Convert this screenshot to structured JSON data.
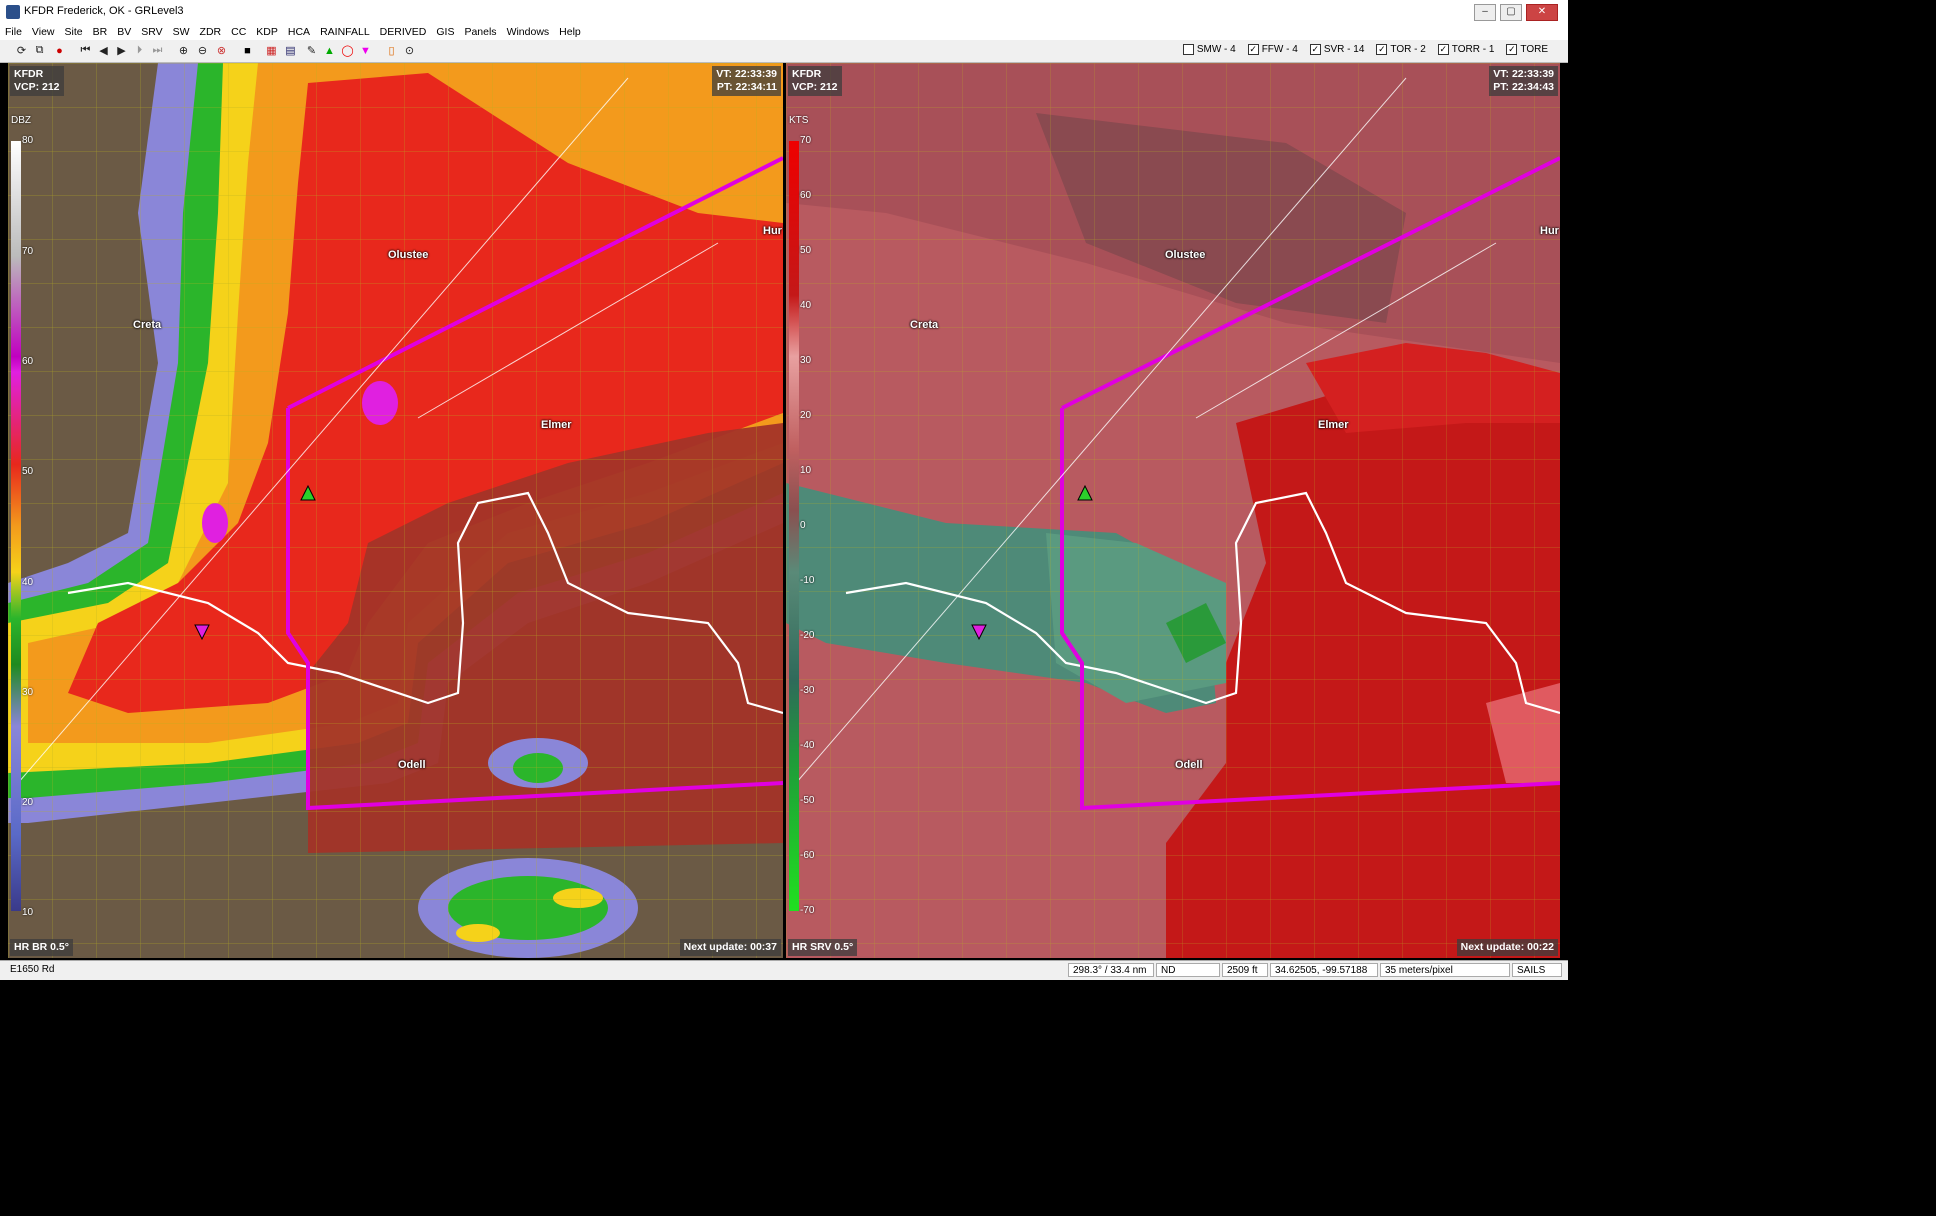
{
  "window": {
    "title": "KFDR Frederick, OK - GRLevel3"
  },
  "menu": [
    "File",
    "View",
    "Site",
    "BR",
    "BV",
    "SRV",
    "SW",
    "ZDR",
    "CC",
    "KDP",
    "HCA",
    "RAINFALL",
    "DERIVED",
    "GIS",
    "Panels",
    "Windows",
    "Help"
  ],
  "warnings": [
    {
      "label": "SMW - 4",
      "checked": false
    },
    {
      "label": "FFW - 4",
      "checked": true
    },
    {
      "label": "SVR - 14",
      "checked": true
    },
    {
      "label": "TOR - 2",
      "checked": true
    },
    {
      "label": "TORR - 1",
      "checked": true
    },
    {
      "label": "TORE",
      "checked": true
    }
  ],
  "left_panel": {
    "site": "KFDR",
    "vcp": "VCP: 212",
    "vt": "VT: 22:33:39",
    "pt": "PT: 22:34:11",
    "product": "HR BR 0.5°",
    "next_update": "Next update: 00:37",
    "unit": "DBZ",
    "scale_labels": [
      "80",
      "70",
      "60",
      "50",
      "40",
      "30",
      "20",
      "10"
    ]
  },
  "right_panel": {
    "site": "KFDR",
    "vcp": "VCP: 212",
    "vt": "VT: 22:33:39",
    "pt": "PT: 22:34:43",
    "product": "HR SRV 0.5°",
    "next_update": "Next update: 00:22",
    "unit": "KTS",
    "scale_labels": [
      "70",
      "60",
      "50",
      "40",
      "30",
      "20",
      "10",
      "0",
      "-10",
      "-20",
      "-30",
      "-40",
      "-50",
      "-60",
      "-70"
    ]
  },
  "towns": {
    "olustee": "Olustee",
    "creta": "Creta",
    "elmer": "Elmer",
    "odell": "Odell",
    "hur": "Hur"
  },
  "status": {
    "location": "E1650 Rd",
    "bearing": "298.3° / 33.4 nm",
    "value": "ND",
    "height": "2509 ft",
    "coords": "34.62505, -99.57188",
    "resolution": "35 meters/pixel",
    "mode": "SAILS"
  },
  "colors": {
    "tor_polygon": "#e000e0",
    "county_outline": "#ffffff",
    "roads": "#b8b020"
  }
}
